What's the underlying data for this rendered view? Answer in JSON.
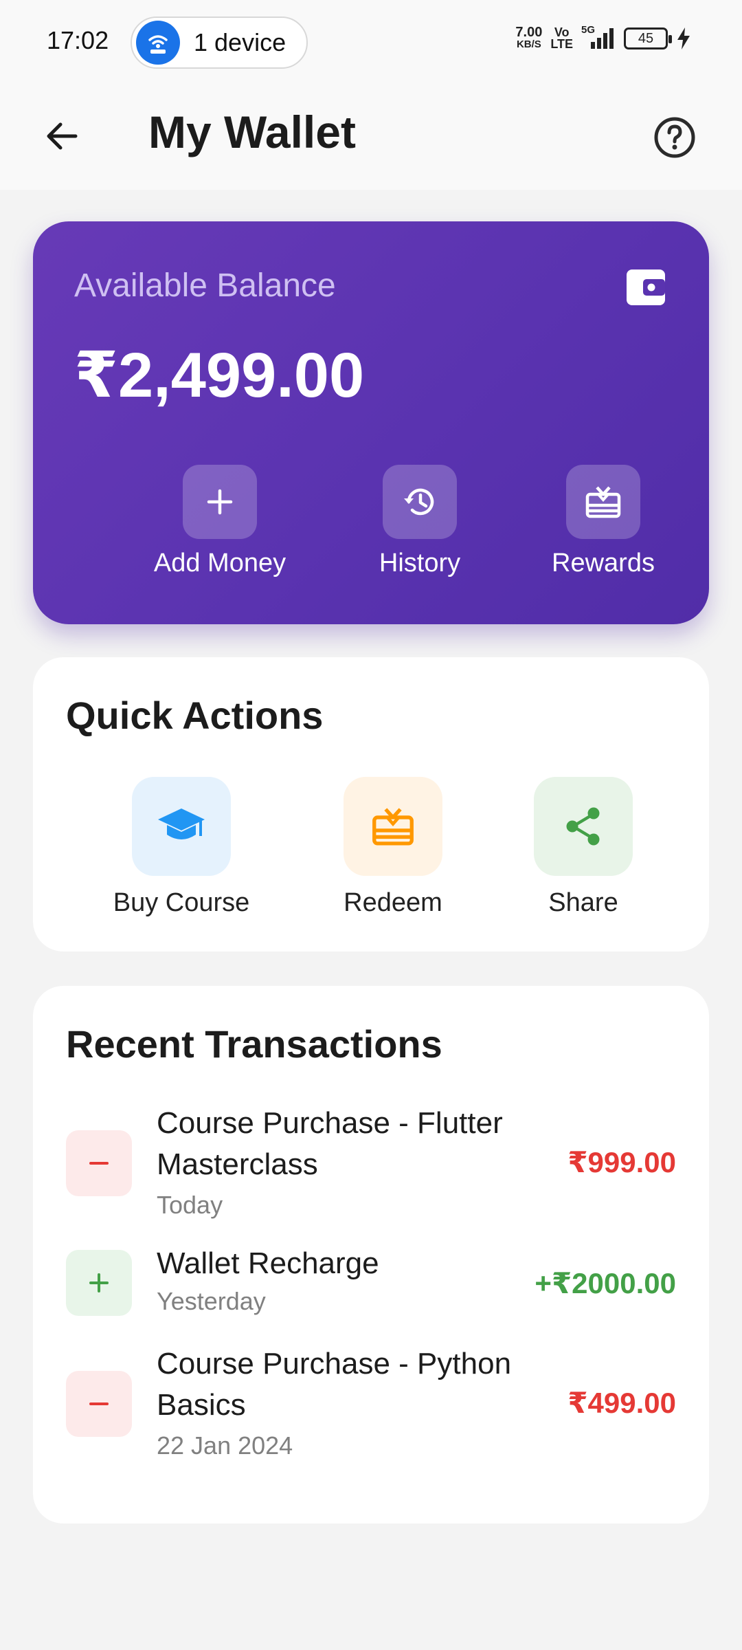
{
  "status_bar": {
    "time": "17:02",
    "hotspot_label": "1 device",
    "net_speed_value": "7.00",
    "net_speed_unit": "KB/S",
    "volte_top": "Vo",
    "volte_bottom": "LTE",
    "network_label": "5G",
    "battery_level": "45"
  },
  "header": {
    "title": "My Wallet"
  },
  "balance_card": {
    "label": "Available Balance",
    "amount": "₹2,499.00",
    "actions": [
      {
        "label": "Add Money",
        "icon": "plus-icon"
      },
      {
        "label": "History",
        "icon": "history-icon"
      },
      {
        "label": "Rewards",
        "icon": "gift-card-icon"
      }
    ]
  },
  "quick_actions": {
    "title": "Quick Actions",
    "items": [
      {
        "label": "Buy Course",
        "icon": "graduation-cap-icon",
        "color": "#2196f3",
        "bg": "#e5f2fd"
      },
      {
        "label": "Redeem",
        "icon": "gift-card-icon",
        "color": "#ff9800",
        "bg": "#fff3e4"
      },
      {
        "label": "Share",
        "icon": "share-icon",
        "color": "#43a047",
        "bg": "#e8f4e8"
      }
    ]
  },
  "transactions": {
    "title": "Recent Transactions",
    "items": [
      {
        "title": "Course Purchase - Flutter Masterclass",
        "date": "Today",
        "amount": "₹999.00",
        "type": "debit"
      },
      {
        "title": "Wallet Recharge",
        "date": "Yesterday",
        "amount": "+₹2000.00",
        "type": "credit"
      },
      {
        "title": "Course Purchase - Python Basics",
        "date": "22 Jan 2024",
        "amount": "₹499.00",
        "type": "debit"
      }
    ]
  },
  "colors": {
    "primary": "#5e35b1",
    "debit": "#e53935",
    "credit": "#43a047",
    "debit_bg": "#fdeaea",
    "credit_bg": "#e8f5e9"
  }
}
